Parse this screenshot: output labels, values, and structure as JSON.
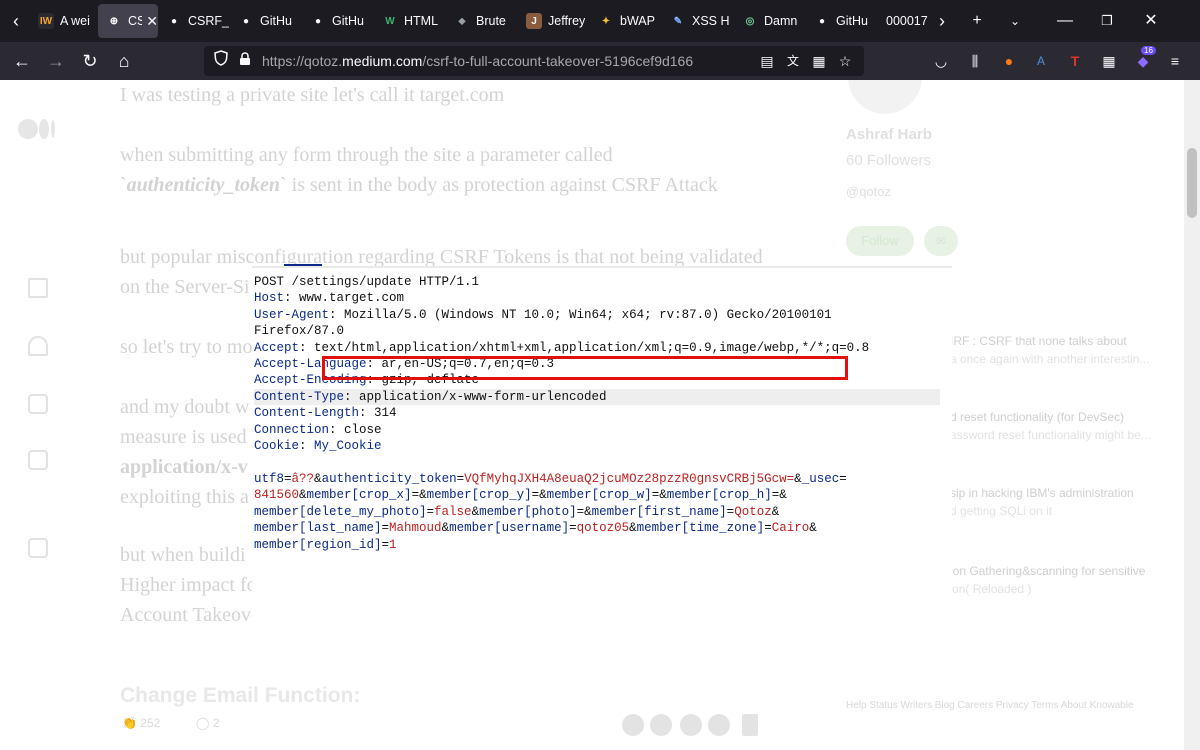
{
  "browser": {
    "tabs": [
      {
        "label": "A wei",
        "fav_text": "IW",
        "fav_bg": "#2b2a33",
        "fav_color": "#f5a623",
        "active": false
      },
      {
        "label": "CSR",
        "fav_text": "⊕",
        "fav_bg": "#42414d",
        "fav_color": "#fbfbfe",
        "active": true
      },
      {
        "label": "CSRF_",
        "fav_text": "●",
        "fav_bg": "#1c1b22",
        "fav_color": "#fbfbfe",
        "active": false
      },
      {
        "label": "GitHu",
        "fav_text": "●",
        "fav_bg": "#1c1b22",
        "fav_color": "#fbfbfe",
        "active": false
      },
      {
        "label": "GitHu",
        "fav_text": "●",
        "fav_bg": "#1c1b22",
        "fav_color": "#fbfbfe",
        "active": false
      },
      {
        "label": "HTML",
        "fav_text": "W",
        "fav_bg": "#1c1b22",
        "fav_color": "#3bb36b",
        "active": false
      },
      {
        "label": "Brute",
        "fav_text": "⬥",
        "fav_bg": "#1c1b22",
        "fav_color": "#9aa0a6",
        "active": false
      },
      {
        "label": "Jeffrey",
        "fav_text": "J",
        "fav_bg": "#8c5a3c",
        "fav_color": "#ffffff",
        "active": false
      },
      {
        "label": "bWAP",
        "fav_text": "✦",
        "fav_bg": "#1c1b22",
        "fav_color": "#f2c230",
        "active": false
      },
      {
        "label": "XSS H",
        "fav_text": "✎",
        "fav_bg": "#1c1b22",
        "fav_color": "#7fb2ff",
        "active": false
      },
      {
        "label": "Damn",
        "fav_text": "◎",
        "fav_bg": "#1c1b22",
        "fav_color": "#6fcf97",
        "active": false
      },
      {
        "label": "GitHu",
        "fav_text": "●",
        "fav_bg": "#1c1b22",
        "fav_color": "#fbfbfe",
        "active": false
      },
      {
        "label": "000017",
        "fav_text": "",
        "fav_bg": "#1c1b22",
        "fav_color": "#fbfbfe",
        "active": false
      }
    ],
    "url_prefix": "https://qotoz.",
    "url_domain": "medium.com",
    "url_path": "/csrf-to-full-account-takeover-5196cef9d166",
    "badge_count": "16"
  },
  "article": {
    "line1": "I was testing a private site let's call it target.com",
    "line2": "when submitting any form through the site a parameter called",
    "line3_pre": "`",
    "line3_em": "authenticity_token",
    "line3_post": "` is sent in the body as protection against CSRF Attack",
    "line4": "but popular misconfiguration regarding CSRF Tokens is that not being validated",
    "line5": "on the Server-Si",
    "line6": "so let's try to mo",
    "line7": "and my doubt w",
    "line8": "measure is used",
    "line9": "application/x-v",
    "line10": "exploiting this a",
    "line11": "but when buildi",
    "line12": "Higher impact for example changing email function as this would lead To",
    "line13": "Account Takeover",
    "heading": "Change Email Function:"
  },
  "sidebar": {
    "author_name": "Ashraf Harb",
    "followers": "60 Followers",
    "handle": "@qotoz",
    "follow_label": "Follow",
    "more": [
      {
        "title": "IRF : CSRF that none talks about",
        "sub": "a once again with another interestin..."
      },
      {
        "title": "d reset functionality (for DevSec)",
        "sub": "assword reset functionality might be..."
      },
      {
        "title": "sip in hacking IBM's administration",
        "sub": "d getting SQLi on it"
      },
      {
        "title": "Information Gathering&scanning for sensitive",
        "sub": "information( Reloaded )"
      }
    ],
    "footer": "Help   Status   Writers   Blog   Careers   Privacy   Terms   About   Knowable"
  },
  "bottom": {
    "claps": "252",
    "comments": "2"
  },
  "request": {
    "lines": [
      {
        "k": "POST /settings/update HTTP/1.1",
        "v": "",
        "kind": "plain"
      },
      {
        "k": "Host",
        "v": "www.target.com",
        "kind": "header"
      },
      {
        "k": "User-Agent",
        "v": "Mozilla/5.0 (Windows NT 10.0; Win64; x64; rv:87.0) Gecko/20100101",
        "kind": "header"
      },
      {
        "k": "",
        "v": "Firefox/87.0",
        "kind": "cont"
      },
      {
        "k": "Accept",
        "v": "text/html,application/xhtml+xml,application/xml;q=0.9,image/webp,*/*;q=0.8",
        "kind": "header"
      },
      {
        "k": "Accept-Language",
        "v": "ar,en-US;q=0.7,en;q=0.3",
        "kind": "header"
      },
      {
        "k": "Accept-Encoding",
        "v": "gzip, deflate",
        "kind": "header"
      },
      {
        "k": "Content-Type",
        "v": "application/x-www-form-urlencoded",
        "kind": "header-hl"
      },
      {
        "k": "Content-Length",
        "v": "314",
        "kind": "header"
      },
      {
        "k": "Connection",
        "v": "close",
        "kind": "header"
      },
      {
        "k": "Cookie",
        "v": "My_Cookie",
        "kind": "cookie"
      }
    ],
    "body": [
      [
        [
          "utf8",
          "=",
          "â??",
          "&"
        ],
        [
          "authenticity_token",
          "=",
          "VQfMyhqJXH4A8euaQ2jcuMOz28pzzR0gnsvCRBj5Gcw=",
          "&"
        ],
        [
          "_usec",
          "=",
          "",
          ""
        ]
      ],
      [
        [
          "",
          "",
          "841560",
          "&"
        ],
        [
          "member[crop_x]",
          "=",
          "",
          "&"
        ],
        [
          "member[crop_y]",
          "=",
          "",
          "&"
        ],
        [
          "member[crop_w]",
          "=",
          "",
          "&"
        ],
        [
          "member[crop_h]",
          "=",
          "",
          "&"
        ]
      ],
      [
        [
          "member[delete_my_photo]",
          "=",
          "false",
          "&"
        ],
        [
          "member[photo]",
          "=",
          "",
          "&"
        ],
        [
          "member[first_name]",
          "=",
          "Qotoz",
          "&"
        ]
      ],
      [
        [
          "member[last_name]",
          "=",
          "Mahmoud",
          "&"
        ],
        [
          "member[username]",
          "=",
          "qotoz05",
          "&"
        ],
        [
          "member[time_zone]",
          "=",
          "Cairo",
          "&"
        ]
      ],
      [
        [
          "member[region_id]",
          "=",
          "1",
          ""
        ]
      ]
    ]
  }
}
